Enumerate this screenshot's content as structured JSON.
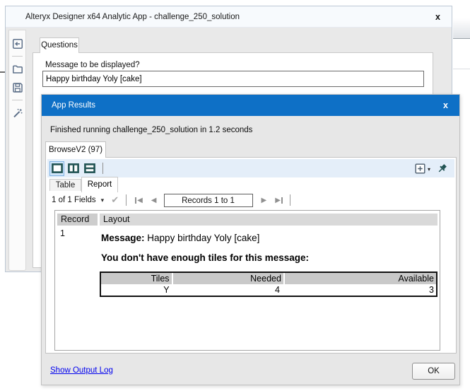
{
  "app_window": {
    "title": "Alteryx Designer x64 Analytic App - challenge_250_solution",
    "close_label": "x",
    "tab_label": "Questions",
    "question": {
      "label": "Message to be displayed?",
      "value": "Happy birthday Yoly [cake]"
    },
    "sidebar_tools": [
      "back",
      "open-workflow",
      "save",
      "wizard"
    ]
  },
  "results_window": {
    "title": "App Results",
    "close_label": "x",
    "status_text": "Finished running challenge_250_solution in 1.2 seconds",
    "browse_tab_label": "BrowseV2 (97)",
    "view_tabs": {
      "table": "Table",
      "report": "Report",
      "active": "Report"
    },
    "record_nav": {
      "fields_selector": "1 of 1 Fields",
      "records_label": "Records 1 to 1"
    },
    "report": {
      "record_column": "Record",
      "layout_column": "Layout",
      "record_id": "1",
      "message_label": "Message:",
      "message_value": "Happy birthday Yoly [cake]",
      "warning_text": "You don't have enough tiles for this message:",
      "tiles_table": {
        "headers": [
          "Tiles",
          "Needed",
          "Available"
        ],
        "row": [
          "Y",
          "4",
          "3"
        ]
      }
    },
    "footer": {
      "link_label": "Show Output Log",
      "ok_label": "OK"
    }
  },
  "icons": {
    "caret_down": "▾",
    "check": "✔",
    "prev": "◀",
    "next": "▶"
  },
  "colors": {
    "titlebar_blue": "#0e70c6",
    "tool_icon_teal": "#215353",
    "sidebar_icon_gray_blue": "#5d7089",
    "link_blue": "#0000ee",
    "selected_tool_bg": "#d0e5f9"
  }
}
